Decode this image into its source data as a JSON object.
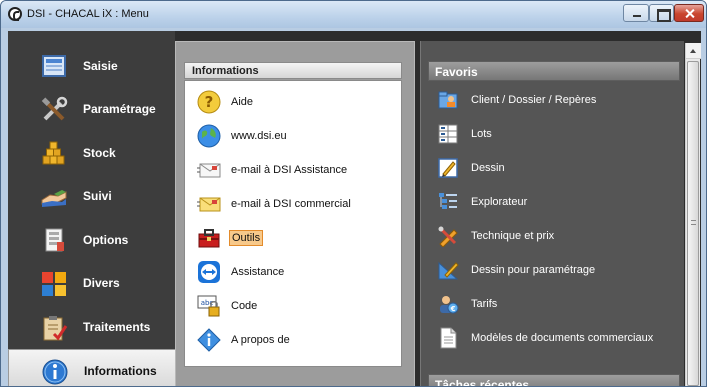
{
  "window": {
    "title": "DSI - CHACAL iX : Menu"
  },
  "left_menu": {
    "items": [
      {
        "label": "Saisie",
        "icon": "screen-icon"
      },
      {
        "label": "Paramétrage",
        "icon": "tools-icon"
      },
      {
        "label": "Stock",
        "icon": "stack-icon"
      },
      {
        "label": "Suivi",
        "icon": "handshake-icon"
      },
      {
        "label": "Options",
        "icon": "options-icon"
      },
      {
        "label": "Divers",
        "icon": "tiles-icon"
      },
      {
        "label": "Traitements",
        "icon": "clipboard-check-icon"
      },
      {
        "label": "Informations",
        "icon": "info-icon"
      }
    ],
    "active": "Informations"
  },
  "info_panel": {
    "header": "Informations",
    "items": [
      {
        "label": "Aide",
        "icon": "help-icon"
      },
      {
        "label": "www.dsi.eu",
        "icon": "globe-icon"
      },
      {
        "label": "e-mail à DSI Assistance",
        "icon": "email-icon"
      },
      {
        "label": "e-mail à DSI commercial",
        "icon": "email-icon"
      },
      {
        "label": "Outils",
        "icon": "toolbox-icon"
      },
      {
        "label": "Assistance",
        "icon": "teamviewer-icon"
      },
      {
        "label": "Code",
        "icon": "code-lock-icon"
      },
      {
        "label": "A propos de",
        "icon": "about-icon"
      }
    ],
    "highlighted": "Outils"
  },
  "favorites": {
    "header": "Favoris",
    "items": [
      {
        "label": "Client / Dossier / Repères",
        "icon": "client-icon"
      },
      {
        "label": "Lots",
        "icon": "lots-icon"
      },
      {
        "label": "Dessin",
        "icon": "drawing-icon"
      },
      {
        "label": "Explorateur",
        "icon": "tree-icon"
      },
      {
        "label": "Technique et prix",
        "icon": "technique-icon"
      },
      {
        "label": "Dessin pour paramétrage",
        "icon": "drawing-param-icon"
      },
      {
        "label": "Tarifs",
        "icon": "tarifs-icon"
      },
      {
        "label": "Modèles de documents commerciaux",
        "icon": "document-icon"
      }
    ]
  },
  "recent": {
    "header": "Tâches récentes"
  },
  "colors": {
    "menu_bg": "#3d3d3d",
    "right_panel_bg": "#555555",
    "highlight": "#f7c98b"
  }
}
